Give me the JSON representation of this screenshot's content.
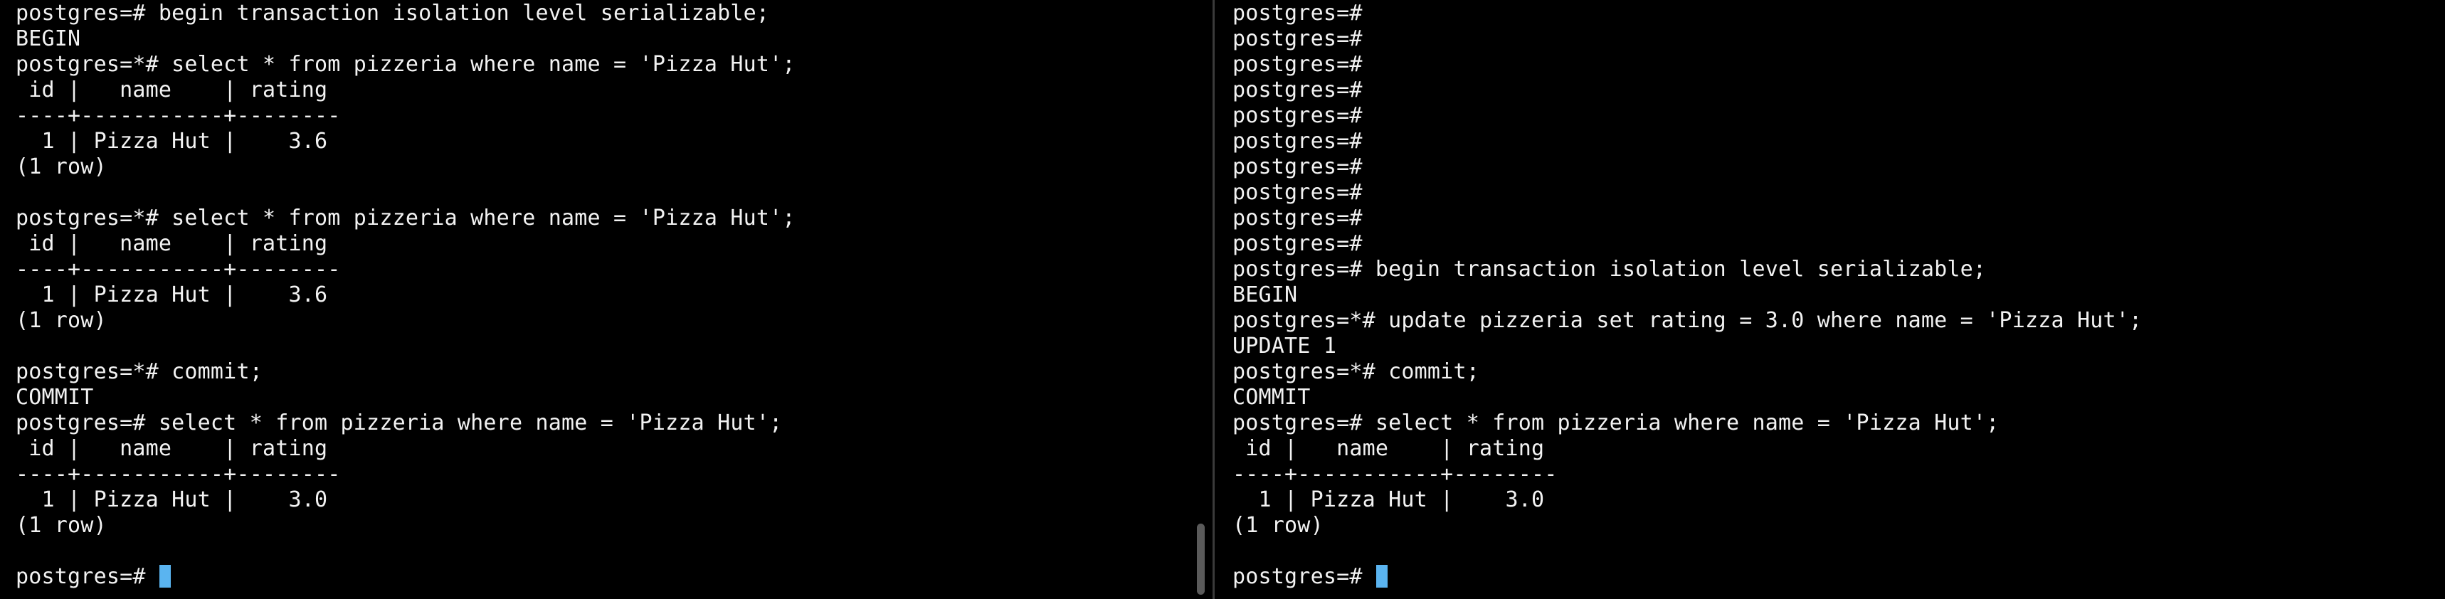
{
  "cursor_color": "#5ab4f0",
  "left_pane": {
    "lines": [
      "postgres=# begin transaction isolation level serializable;",
      "BEGIN",
      "postgres=*# select * from pizzeria where name = 'Pizza Hut';",
      " id |   name    | rating",
      "----+-----------+--------",
      "  1 | Pizza Hut |    3.6",
      "(1 row)",
      "",
      "postgres=*# select * from pizzeria where name = 'Pizza Hut';",
      " id |   name    | rating",
      "----+-----------+--------",
      "  1 | Pizza Hut |    3.6",
      "(1 row)",
      "",
      "postgres=*# commit;",
      "COMMIT",
      "postgres=# select * from pizzeria where name = 'Pizza Hut';",
      " id |   name    | rating",
      "----+-----------+--------",
      "  1 | Pizza Hut |    3.0",
      "(1 row)",
      "",
      "postgres=# "
    ]
  },
  "right_pane": {
    "lines": [
      "postgres=#",
      "postgres=#",
      "postgres=#",
      "postgres=#",
      "postgres=#",
      "postgres=#",
      "postgres=#",
      "postgres=#",
      "postgres=#",
      "postgres=#",
      "postgres=# begin transaction isolation level serializable;",
      "BEGIN",
      "postgres=*# update pizzeria set rating = 3.0 where name = 'Pizza Hut';",
      "UPDATE 1",
      "postgres=*# commit;",
      "COMMIT",
      "postgres=# select * from pizzeria where name = 'Pizza Hut';",
      " id |   name    | rating",
      "----+-----------+--------",
      "  1 | Pizza Hut |    3.0",
      "(1 row)",
      "",
      "postgres=# "
    ]
  }
}
